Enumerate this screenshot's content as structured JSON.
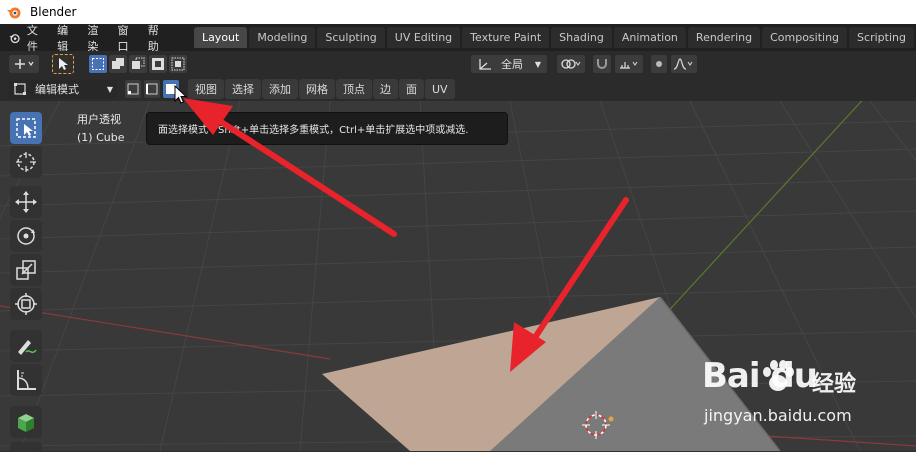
{
  "window": {
    "title": "Blender"
  },
  "menu": [
    "文件",
    "编辑",
    "渲染",
    "窗口",
    "帮助"
  ],
  "workspace_tabs": [
    {
      "label": "Layout",
      "active": true
    },
    {
      "label": "Modeling",
      "active": false
    },
    {
      "label": "Sculpting",
      "active": false
    },
    {
      "label": "UV Editing",
      "active": false
    },
    {
      "label": "Texture Paint",
      "active": false
    },
    {
      "label": "Shading",
      "active": false
    },
    {
      "label": "Animation",
      "active": false
    },
    {
      "label": "Rendering",
      "active": false
    },
    {
      "label": "Compositing",
      "active": false
    },
    {
      "label": "Scripting",
      "active": false
    }
  ],
  "header": {
    "transform_orientation": "全局"
  },
  "edit_header": {
    "mode": "编辑模式",
    "menus": [
      "视图",
      "选择",
      "添加",
      "网格",
      "顶点",
      "边",
      "面",
      "UV"
    ]
  },
  "viewport": {
    "view_name": "用户透视",
    "object_name": "(1) Cube"
  },
  "tooltip": {
    "text": "面选择模式 - Shift+单击选择多重模式，Ctrl+单击扩展选中项或减选."
  },
  "watermark": {
    "brand": "Bai  du",
    "cn": "经验",
    "url": "jingyan.baidu.com"
  },
  "colors": {
    "accent": "#4772b3",
    "annotation_arrow": "#e8232b",
    "face_selected": "#bfa594",
    "mesh_gray": "#7a7a7a"
  }
}
